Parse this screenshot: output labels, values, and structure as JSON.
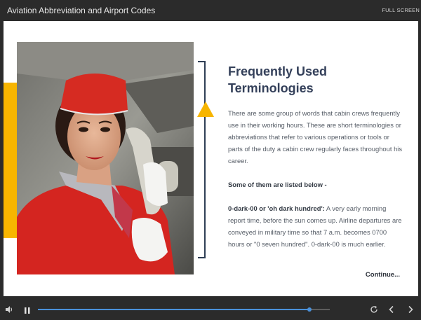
{
  "window": {
    "title": "Aviation Abbreviation and Airport Codes",
    "fullscreen_label": "FULL SCREEN"
  },
  "slide": {
    "heading_line1": "Frequently Used",
    "heading_line2": "Terminologies",
    "paragraph1": "There are some group of words that cabin crews frequently use in their working hours. These are short terminologies or abbreviations that refer to various operations or tools or parts of the duty a cabin crew regularly faces throughout his career.",
    "list_intro": "Some of them are listed below -",
    "term_label": "0-dark-00 or 'oh dark hundred':",
    "term_text": " A very early morning report time, before the sun comes up. Airline departures are conveyed in military time so that 7 a.m. becomes 0700 hours or \"0 seven hundred\". 0-dark-00 is much earlier.",
    "continue_label": "Continue...",
    "accent_color": "#f7b500",
    "heading_color": "#34405a"
  },
  "player": {
    "progress": 0.93,
    "icons": {
      "volume": "volume-icon",
      "pause": "pause-icon",
      "replay": "replay-icon",
      "previous": "chevron-left-icon",
      "next": "chevron-right-icon"
    }
  }
}
